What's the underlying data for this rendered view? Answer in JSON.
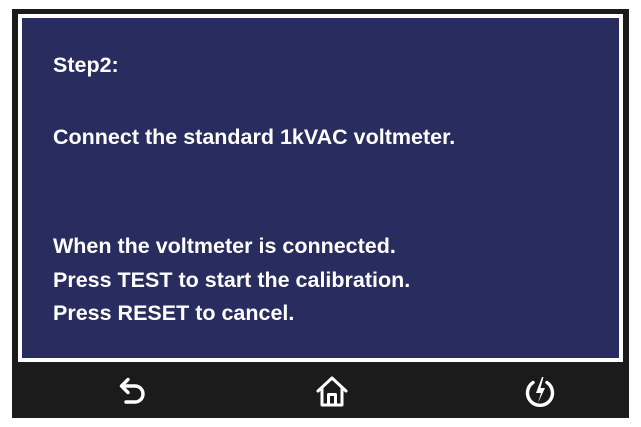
{
  "screen": {
    "step_title": "Step2:",
    "instruction": "Connect the standard 1kVAC voltmeter.",
    "lines": [
      "When the voltmeter is connected.",
      "Press TEST to start the calibration.",
      "Press RESET to cancel."
    ]
  },
  "nav": {
    "back_icon": "back-arrow-icon",
    "home_icon": "home-icon",
    "power_icon": "power-icon"
  },
  "colors": {
    "screen_background": "#282c5e",
    "frame": "#1b1b1b",
    "text": "#ffffff"
  }
}
